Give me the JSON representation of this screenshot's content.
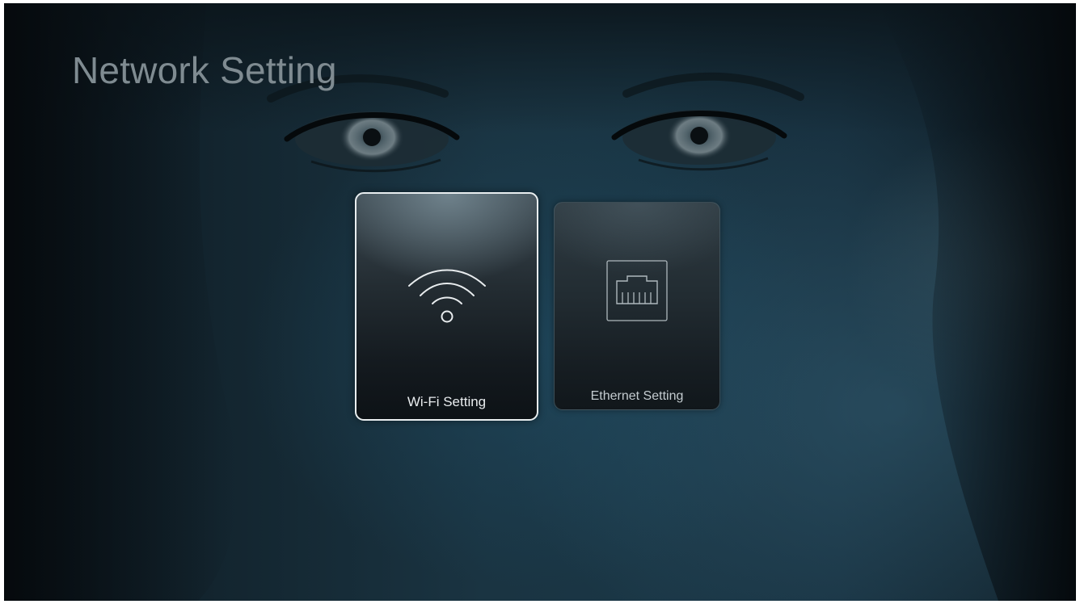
{
  "page": {
    "title": "Network Setting"
  },
  "tiles": [
    {
      "label": "Wi-Fi Setting",
      "icon": "wifi-icon",
      "selected": true
    },
    {
      "label": "Ethernet Setting",
      "icon": "ethernet-port-icon",
      "selected": false
    }
  ],
  "theme": {
    "background": "#1a3442",
    "title_color": "#7f8b91",
    "selected_border": "#e9eef0"
  }
}
